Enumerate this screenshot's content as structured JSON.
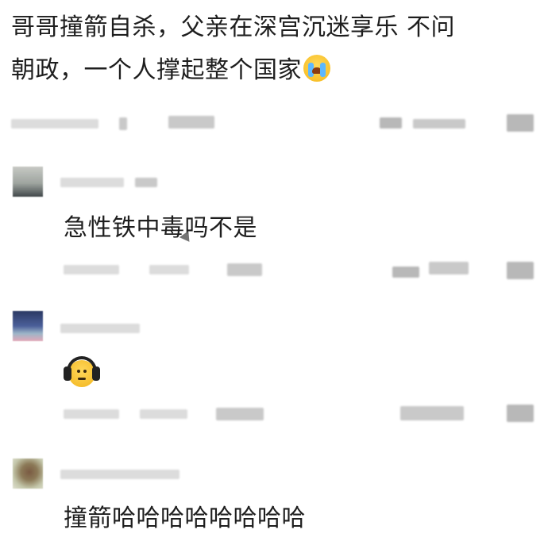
{
  "post": {
    "text_line1": "哥哥撞箭自杀，父亲在深宫沉迷享乐 不问",
    "text_line2": "朝政，一个人撑起整个国家",
    "emoji_icon": "crying-face-icon"
  },
  "comments": [
    {
      "avatar_icon": "user-avatar-icon",
      "text": "急性铁中毒吗不是"
    },
    {
      "avatar_icon": "user-avatar-icon",
      "emoji_icon": "headphones-face-icon"
    },
    {
      "avatar_icon": "user-avatar-icon",
      "text": "撞箭哈哈哈哈哈哈哈哈"
    }
  ],
  "colors": {
    "background": "#ffffff",
    "text": "#1e1e1e",
    "blurred_meta": "#dcdcdc"
  }
}
